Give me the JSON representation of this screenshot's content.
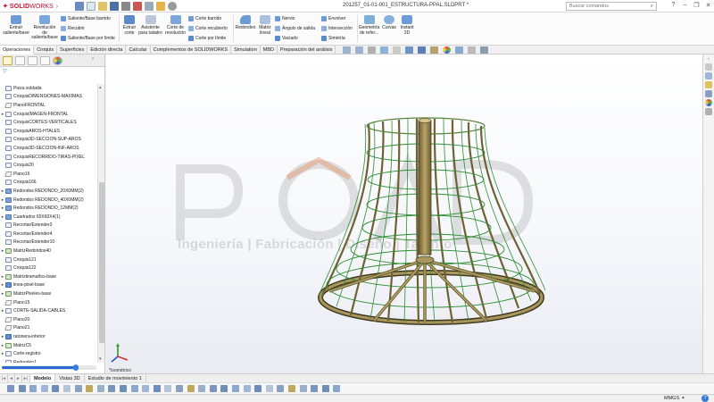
{
  "app": {
    "brand_solid": "SOLID",
    "brand_works": "WORKS",
    "document_title": "201257_01-01-001_ESTRUCTURA-PPAL.SLDPRT *",
    "search_placeholder": "Buscar comandos"
  },
  "ribbon": {
    "big": [
      {
        "label": "Extruir saliente/base",
        "icon": "extrude-boss-icon"
      },
      {
        "label": "Revolución de saliente/base",
        "icon": "revolve-boss-icon"
      },
      {
        "label": "Extruir corte",
        "icon": "extrude-cut-icon"
      },
      {
        "label": "Asistente para taladro",
        "icon": "hole-wizard-icon"
      },
      {
        "label": "Corte de revolución",
        "icon": "revolve-cut-icon"
      },
      {
        "label": "Redondeo",
        "icon": "fillet-icon"
      },
      {
        "label": "Matriz lineal",
        "icon": "linear-pattern-icon"
      },
      {
        "label": "Geometría de refer...",
        "icon": "reference-geometry-icon"
      },
      {
        "label": "Curvas",
        "icon": "curves-icon"
      },
      {
        "label": "Instant 3D",
        "icon": "instant3d-icon"
      }
    ],
    "small": [
      {
        "label": "Saliente/Base barrido",
        "icon": "swept-boss-icon"
      },
      {
        "label": "Recubrir",
        "icon": "loft-icon"
      },
      {
        "label": "Saliente/Base por límite",
        "icon": "boundary-boss-icon"
      },
      {
        "label": "Corte barrido",
        "icon": "swept-cut-icon"
      },
      {
        "label": "Corte recubierto",
        "icon": "lofted-cut-icon"
      },
      {
        "label": "Corte por límite",
        "icon": "boundary-cut-icon"
      },
      {
        "label": "Nervio",
        "icon": "rib-icon"
      },
      {
        "label": "Ángulo de salida",
        "icon": "draft-icon"
      },
      {
        "label": "Vaciado",
        "icon": "shell-icon"
      },
      {
        "label": "Envolver",
        "icon": "wrap-icon"
      },
      {
        "label": "Intersección",
        "icon": "intersect-icon"
      },
      {
        "label": "Simetría",
        "icon": "mirror-icon"
      }
    ]
  },
  "tabs": [
    "Operaciones",
    "Croquis",
    "Superficies",
    "Edición directa",
    "Calcular",
    "Complementos de SOLIDWORKS",
    "Simulation",
    "MBD",
    "Preparación del análisis"
  ],
  "tree": [
    {
      "label": "Pieza soldada",
      "icon": "weldment-icon",
      "exp": ""
    },
    {
      "label": "CroquisDIMENSIONES-MAXIMAS",
      "icon": "sketch-icon",
      "exp": ""
    },
    {
      "label": "PlanoFRONTAL",
      "icon": "plane-icon",
      "exp": ""
    },
    {
      "label": "CroquisIMAGEN-FRONTAL",
      "icon": "sketch-icon",
      "exp": ">"
    },
    {
      "label": "CroquisCORTES-VERTICALES",
      "icon": "sketch-icon",
      "exp": ""
    },
    {
      "label": "CroquisAROS-HTALES",
      "icon": "sketch-icon",
      "exp": ""
    },
    {
      "label": "Croquis3D-SECCION-SUP-AROS",
      "icon": "sketch3d-icon",
      "exp": ""
    },
    {
      "label": "Croquis3D-SECCION-INF-AROS",
      "icon": "sketch3d-icon",
      "exp": ""
    },
    {
      "label": "CroquisRECORRIDO-TIRAS-PIXEL",
      "icon": "sketch-icon",
      "exp": ""
    },
    {
      "label": "Croquis20",
      "icon": "sketch-icon",
      "exp": ""
    },
    {
      "label": "Plano16",
      "icon": "plane-icon",
      "exp": ""
    },
    {
      "label": "Croquis166",
      "icon": "sketch-icon",
      "exp": ""
    },
    {
      "label": "Redondos REDONDO_20X0MM(2)",
      "icon": "folder-icon",
      "exp": ">"
    },
    {
      "label": "Redondos REDONDO_40X0MM(2)",
      "icon": "folder-icon",
      "exp": ">"
    },
    {
      "label": "Redondos REDONDO_12MM(2)",
      "icon": "folder-icon",
      "exp": ">"
    },
    {
      "label": "Cuadrados 60X60X4(1)",
      "icon": "folder-icon",
      "exp": ">"
    },
    {
      "label": "Recortar/Extender3",
      "icon": "trim-icon",
      "exp": ""
    },
    {
      "label": "Recortar/Extender4",
      "icon": "trim-icon",
      "exp": ""
    },
    {
      "label": "Recortar/Extender10",
      "icon": "trim-icon",
      "exp": ""
    },
    {
      "label": "MatrizRedondos40",
      "icon": "pattern-icon",
      "exp": ">"
    },
    {
      "label": "Croquis121",
      "icon": "sketch-icon",
      "exp": ""
    },
    {
      "label": "Croquis122",
      "icon": "sketch-icon",
      "exp": ""
    },
    {
      "label": "Matriztiramaños-base",
      "icon": "pattern-icon",
      "exp": ">"
    },
    {
      "label": "linea-pixel-base",
      "icon": "part-icon",
      "exp": ">"
    },
    {
      "label": "MatrizPixeles-base",
      "icon": "pattern-icon",
      "exp": ">"
    },
    {
      "label": "Plano15",
      "icon": "plane-icon",
      "exp": ""
    },
    {
      "label": "CORTE-SALIDA-CABLES",
      "icon": "cut-icon",
      "exp": ">"
    },
    {
      "label": "Plano20",
      "icon": "plane-icon",
      "exp": ""
    },
    {
      "label": "Plano21",
      "icon": "plane-icon",
      "exp": ""
    },
    {
      "label": "ratonera-inferior",
      "icon": "part-icon",
      "exp": ">"
    },
    {
      "label": "MatrizC5",
      "icon": "pattern-icon",
      "exp": ">"
    },
    {
      "label": "Corte-registro",
      "icon": "cut-icon",
      "exp": ">"
    },
    {
      "label": "Redondeo1",
      "icon": "fillet-icon",
      "exp": ""
    }
  ],
  "viewport": {
    "view_label": "*Isométrico",
    "watermark_sub": "Ingeniería | Fabricación | Diseño | Talento"
  },
  "model_tabs": [
    "Modelo",
    "Vistas 3D",
    "Estudio de movimiento 1"
  ],
  "status": {
    "units": "MMGS"
  }
}
